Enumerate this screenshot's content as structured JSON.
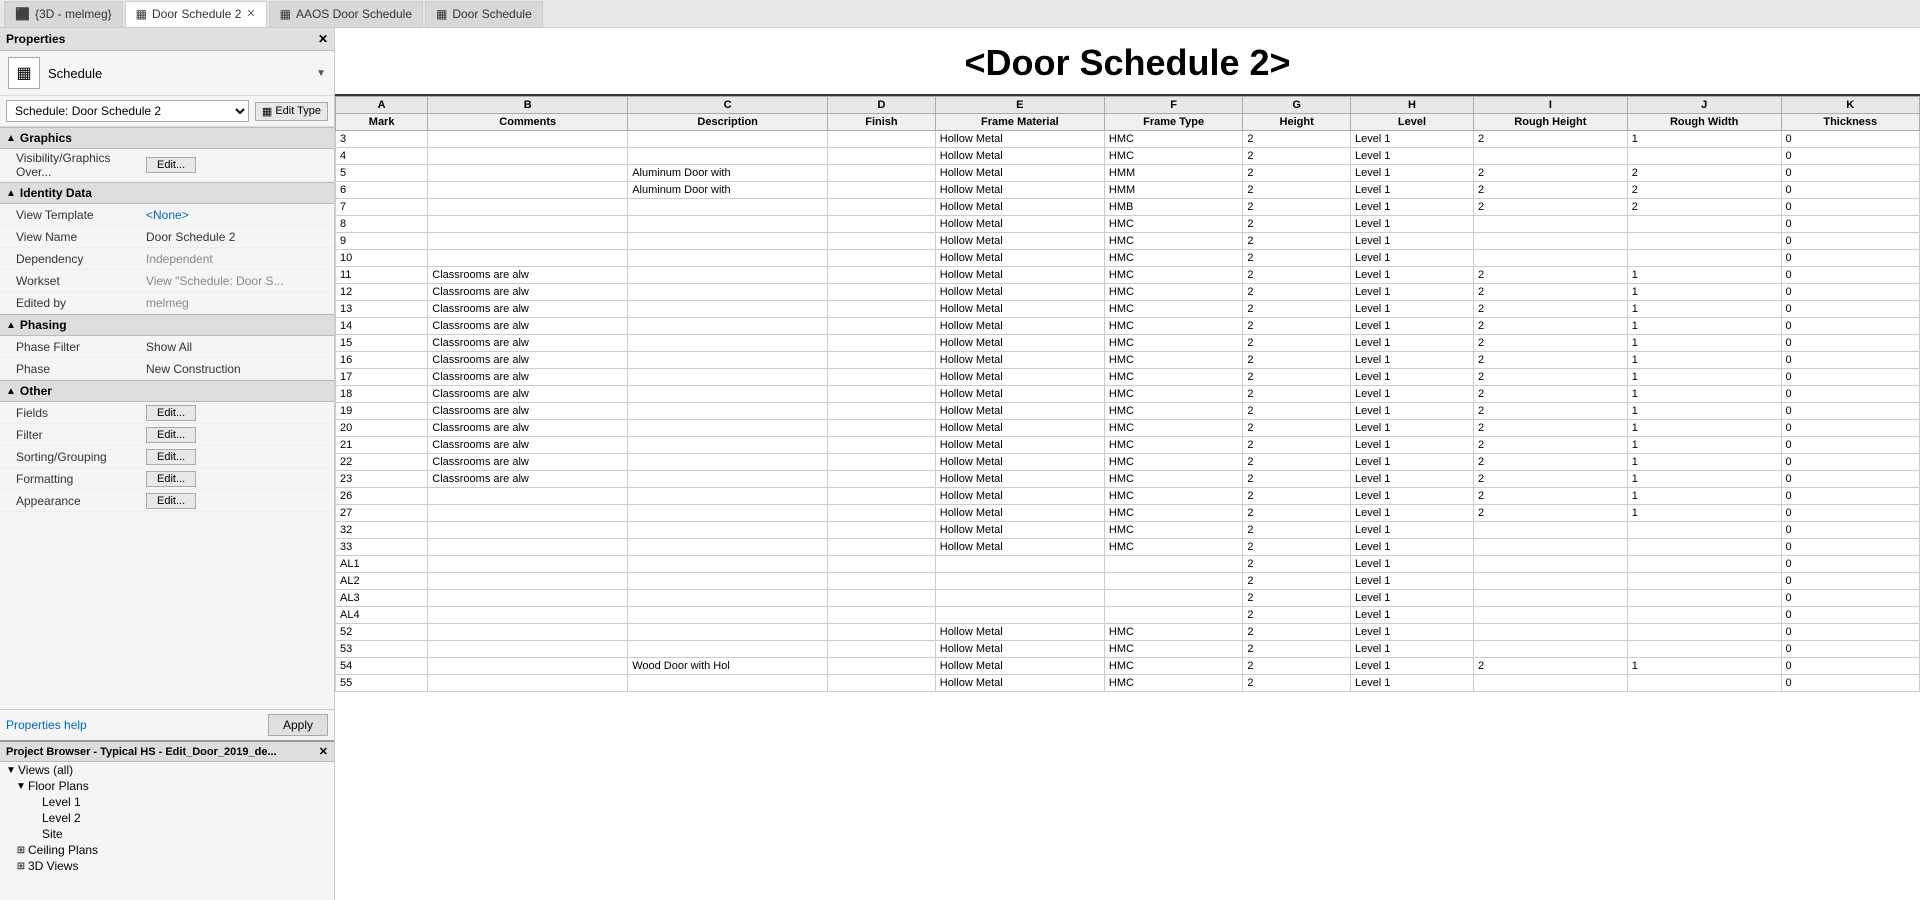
{
  "tabs": [
    {
      "id": "3d",
      "label": "{3D - melmeg}",
      "icon": "3d",
      "active": false,
      "closeable": false
    },
    {
      "id": "door2",
      "label": "Door Schedule 2",
      "icon": "table",
      "active": true,
      "closeable": true
    },
    {
      "id": "aaos",
      "label": "AAOS Door Schedule",
      "icon": "table",
      "active": false,
      "closeable": false
    },
    {
      "id": "door",
      "label": "Door Schedule",
      "icon": "table",
      "active": false,
      "closeable": false
    }
  ],
  "properties_panel": {
    "title": "Properties",
    "schedule_icon": "⊞",
    "schedule_type_label": "Schedule",
    "schedule_name": "Schedule: Door Schedule 2",
    "edit_type_label": "Edit Type",
    "sections": {
      "graphics": {
        "label": "Graphics",
        "items": [
          {
            "label": "Visibility/Graphics Over...",
            "value": "Edit...",
            "is_button": true
          }
        ]
      },
      "identity_data": {
        "label": "Identity Data",
        "items": [
          {
            "label": "View Template",
            "value": "<None>",
            "is_link": true
          },
          {
            "label": "View Name",
            "value": "Door Schedule 2",
            "is_button": false
          },
          {
            "label": "Dependency",
            "value": "Independent",
            "is_grayed": true
          },
          {
            "label": "Workset",
            "value": "View \"Schedule: Door S...",
            "is_grayed": true
          },
          {
            "label": "Edited by",
            "value": "melmeg",
            "is_grayed": true
          }
        ]
      },
      "phasing": {
        "label": "Phasing",
        "items": [
          {
            "label": "Phase Filter",
            "value": "Show All"
          },
          {
            "label": "Phase",
            "value": "New Construction"
          }
        ]
      },
      "other": {
        "label": "Other",
        "items": [
          {
            "label": "Fields",
            "value": "Edit...",
            "is_button": true
          },
          {
            "label": "Filter",
            "value": "Edit...",
            "is_button": true
          },
          {
            "label": "Sorting/Grouping",
            "value": "Edit...",
            "is_button": true
          },
          {
            "label": "Formatting",
            "value": "Edit...",
            "is_button": true
          },
          {
            "label": "Appearance",
            "value": "Edit...",
            "is_button": true
          }
        ]
      }
    },
    "properties_help_label": "Properties help",
    "apply_label": "Apply"
  },
  "project_browser": {
    "title": "Project Browser - Typical HS - Edit_Door_2019_de...",
    "tree": [
      {
        "label": "Views (all)",
        "indent": 0,
        "expand": "▼",
        "icon": "📁"
      },
      {
        "label": "Floor Plans",
        "indent": 1,
        "expand": "▼",
        "icon": "📁"
      },
      {
        "label": "Level 1",
        "indent": 2,
        "expand": "",
        "icon": "📄"
      },
      {
        "label": "Level 2",
        "indent": 2,
        "expand": "",
        "icon": "📄"
      },
      {
        "label": "Site",
        "indent": 2,
        "expand": "",
        "icon": "📄"
      },
      {
        "label": "Ceiling Plans",
        "indent": 1,
        "expand": "⊞",
        "icon": "📁"
      },
      {
        "label": "3D Views",
        "indent": 1,
        "expand": "⊞",
        "icon": "📁"
      }
    ]
  },
  "schedule": {
    "title": "<Door Schedule 2>",
    "columns": [
      {
        "letter": "A",
        "name": "Mark",
        "class": "col-a"
      },
      {
        "letter": "B",
        "name": "Comments",
        "class": "col-b"
      },
      {
        "letter": "C",
        "name": "Description",
        "class": "col-c"
      },
      {
        "letter": "D",
        "name": "Finish",
        "class": "col-d"
      },
      {
        "letter": "E",
        "name": "Frame Material",
        "class": "col-e"
      },
      {
        "letter": "F",
        "name": "Frame Type",
        "class": "col-f"
      },
      {
        "letter": "G",
        "name": "Height",
        "class": "col-g"
      },
      {
        "letter": "H",
        "name": "Level",
        "class": "col-h"
      },
      {
        "letter": "I",
        "name": "Rough Height",
        "class": "col-i"
      },
      {
        "letter": "J",
        "name": "Rough Width",
        "class": "col-j"
      },
      {
        "letter": "K",
        "name": "Thickness",
        "class": "col-k"
      }
    ],
    "rows": [
      {
        "mark": "3",
        "comments": "",
        "description": "",
        "finish": "",
        "frame_material": "Hollow Metal",
        "frame_type": "HMC",
        "height": "2",
        "level": "Level 1",
        "rough_height": "2",
        "rough_width": "1",
        "thickness": "0"
      },
      {
        "mark": "4",
        "comments": "",
        "description": "",
        "finish": "",
        "frame_material": "Hollow Metal",
        "frame_type": "HMC",
        "height": "2",
        "level": "Level 1",
        "rough_height": "",
        "rough_width": "",
        "thickness": "0"
      },
      {
        "mark": "5",
        "comments": "",
        "description": "Aluminum Door with",
        "finish": "",
        "frame_material": "Hollow Metal",
        "frame_type": "HMM",
        "height": "2",
        "level": "Level 1",
        "rough_height": "2",
        "rough_width": "2",
        "thickness": "0"
      },
      {
        "mark": "6",
        "comments": "",
        "description": "Aluminum Door with",
        "finish": "",
        "frame_material": "Hollow Metal",
        "frame_type": "HMM",
        "height": "2",
        "level": "Level 1",
        "rough_height": "2",
        "rough_width": "2",
        "thickness": "0"
      },
      {
        "mark": "7",
        "comments": "",
        "description": "",
        "finish": "",
        "frame_material": "Hollow Metal",
        "frame_type": "HMB",
        "height": "2",
        "level": "Level 1",
        "rough_height": "2",
        "rough_width": "2",
        "thickness": "0"
      },
      {
        "mark": "8",
        "comments": "",
        "description": "",
        "finish": "",
        "frame_material": "Hollow Metal",
        "frame_type": "HMC",
        "height": "2",
        "level": "Level 1",
        "rough_height": "",
        "rough_width": "",
        "thickness": "0"
      },
      {
        "mark": "9",
        "comments": "",
        "description": "",
        "finish": "",
        "frame_material": "Hollow Metal",
        "frame_type": "HMC",
        "height": "2",
        "level": "Level 1",
        "rough_height": "",
        "rough_width": "",
        "thickness": "0"
      },
      {
        "mark": "10",
        "comments": "",
        "description": "",
        "finish": "",
        "frame_material": "Hollow Metal",
        "frame_type": "HMC",
        "height": "2",
        "level": "Level 1",
        "rough_height": "",
        "rough_width": "",
        "thickness": "0"
      },
      {
        "mark": "11",
        "comments": "Classrooms are alw",
        "description": "",
        "finish": "",
        "frame_material": "Hollow Metal",
        "frame_type": "HMC",
        "height": "2",
        "level": "Level 1",
        "rough_height": "2",
        "rough_width": "1",
        "thickness": "0"
      },
      {
        "mark": "12",
        "comments": "Classrooms are alw",
        "description": "",
        "finish": "",
        "frame_material": "Hollow Metal",
        "frame_type": "HMC",
        "height": "2",
        "level": "Level 1",
        "rough_height": "2",
        "rough_width": "1",
        "thickness": "0"
      },
      {
        "mark": "13",
        "comments": "Classrooms are alw",
        "description": "",
        "finish": "",
        "frame_material": "Hollow Metal",
        "frame_type": "HMC",
        "height": "2",
        "level": "Level 1",
        "rough_height": "2",
        "rough_width": "1",
        "thickness": "0"
      },
      {
        "mark": "14",
        "comments": "Classrooms are alw",
        "description": "",
        "finish": "",
        "frame_material": "Hollow Metal",
        "frame_type": "HMC",
        "height": "2",
        "level": "Level 1",
        "rough_height": "2",
        "rough_width": "1",
        "thickness": "0"
      },
      {
        "mark": "15",
        "comments": "Classrooms are alw",
        "description": "",
        "finish": "",
        "frame_material": "Hollow Metal",
        "frame_type": "HMC",
        "height": "2",
        "level": "Level 1",
        "rough_height": "2",
        "rough_width": "1",
        "thickness": "0"
      },
      {
        "mark": "16",
        "comments": "Classrooms are alw",
        "description": "",
        "finish": "",
        "frame_material": "Hollow Metal",
        "frame_type": "HMC",
        "height": "2",
        "level": "Level 1",
        "rough_height": "2",
        "rough_width": "1",
        "thickness": "0"
      },
      {
        "mark": "17",
        "comments": "Classrooms are alw",
        "description": "",
        "finish": "",
        "frame_material": "Hollow Metal",
        "frame_type": "HMC",
        "height": "2",
        "level": "Level 1",
        "rough_height": "2",
        "rough_width": "1",
        "thickness": "0"
      },
      {
        "mark": "18",
        "comments": "Classrooms are alw",
        "description": "",
        "finish": "",
        "frame_material": "Hollow Metal",
        "frame_type": "HMC",
        "height": "2",
        "level": "Level 1",
        "rough_height": "2",
        "rough_width": "1",
        "thickness": "0"
      },
      {
        "mark": "19",
        "comments": "Classrooms are alw",
        "description": "",
        "finish": "",
        "frame_material": "Hollow Metal",
        "frame_type": "HMC",
        "height": "2",
        "level": "Level 1",
        "rough_height": "2",
        "rough_width": "1",
        "thickness": "0"
      },
      {
        "mark": "20",
        "comments": "Classrooms are alw",
        "description": "",
        "finish": "",
        "frame_material": "Hollow Metal",
        "frame_type": "HMC",
        "height": "2",
        "level": "Level 1",
        "rough_height": "2",
        "rough_width": "1",
        "thickness": "0"
      },
      {
        "mark": "21",
        "comments": "Classrooms are alw",
        "description": "",
        "finish": "",
        "frame_material": "Hollow Metal",
        "frame_type": "HMC",
        "height": "2",
        "level": "Level 1",
        "rough_height": "2",
        "rough_width": "1",
        "thickness": "0"
      },
      {
        "mark": "22",
        "comments": "Classrooms are alw",
        "description": "",
        "finish": "",
        "frame_material": "Hollow Metal",
        "frame_type": "HMC",
        "height": "2",
        "level": "Level 1",
        "rough_height": "2",
        "rough_width": "1",
        "thickness": "0"
      },
      {
        "mark": "23",
        "comments": "Classrooms are alw",
        "description": "",
        "finish": "",
        "frame_material": "Hollow Metal",
        "frame_type": "HMC",
        "height": "2",
        "level": "Level 1",
        "rough_height": "2",
        "rough_width": "1",
        "thickness": "0"
      },
      {
        "mark": "26",
        "comments": "",
        "description": "",
        "finish": "",
        "frame_material": "Hollow Metal",
        "frame_type": "HMC",
        "height": "2",
        "level": "Level 1",
        "rough_height": "2",
        "rough_width": "1",
        "thickness": "0"
      },
      {
        "mark": "27",
        "comments": "",
        "description": "",
        "finish": "",
        "frame_material": "Hollow Metal",
        "frame_type": "HMC",
        "height": "2",
        "level": "Level 1",
        "rough_height": "2",
        "rough_width": "1",
        "thickness": "0"
      },
      {
        "mark": "32",
        "comments": "",
        "description": "",
        "finish": "",
        "frame_material": "Hollow Metal",
        "frame_type": "HMC",
        "height": "2",
        "level": "Level 1",
        "rough_height": "",
        "rough_width": "",
        "thickness": "0"
      },
      {
        "mark": "33",
        "comments": "",
        "description": "",
        "finish": "",
        "frame_material": "Hollow Metal",
        "frame_type": "HMC",
        "height": "2",
        "level": "Level 1",
        "rough_height": "",
        "rough_width": "",
        "thickness": "0"
      },
      {
        "mark": "AL1",
        "comments": "",
        "description": "",
        "finish": "",
        "frame_material": "",
        "frame_type": "",
        "height": "2",
        "level": "Level 1",
        "rough_height": "",
        "rough_width": "",
        "thickness": "0"
      },
      {
        "mark": "AL2",
        "comments": "",
        "description": "",
        "finish": "",
        "frame_material": "",
        "frame_type": "",
        "height": "2",
        "level": "Level 1",
        "rough_height": "",
        "rough_width": "",
        "thickness": "0"
      },
      {
        "mark": "AL3",
        "comments": "",
        "description": "",
        "finish": "",
        "frame_material": "",
        "frame_type": "",
        "height": "2",
        "level": "Level 1",
        "rough_height": "",
        "rough_width": "",
        "thickness": "0"
      },
      {
        "mark": "AL4",
        "comments": "",
        "description": "",
        "finish": "",
        "frame_material": "",
        "frame_type": "",
        "height": "2",
        "level": "Level 1",
        "rough_height": "",
        "rough_width": "",
        "thickness": "0"
      },
      {
        "mark": "52",
        "comments": "",
        "description": "",
        "finish": "",
        "frame_material": "Hollow Metal",
        "frame_type": "HMC",
        "height": "2",
        "level": "Level 1",
        "rough_height": "",
        "rough_width": "",
        "thickness": "0"
      },
      {
        "mark": "53",
        "comments": "",
        "description": "",
        "finish": "",
        "frame_material": "Hollow Metal",
        "frame_type": "HMC",
        "height": "2",
        "level": "Level 1",
        "rough_height": "",
        "rough_width": "",
        "thickness": "0"
      },
      {
        "mark": "54",
        "comments": "",
        "description": "Wood Door with Hol",
        "finish": "",
        "frame_material": "Hollow Metal",
        "frame_type": "HMC",
        "height": "2",
        "level": "Level 1",
        "rough_height": "2",
        "rough_width": "1",
        "thickness": "0"
      },
      {
        "mark": "55",
        "comments": "",
        "description": "",
        "finish": "",
        "frame_material": "Hollow Metal",
        "frame_type": "HMC",
        "height": "2",
        "level": "Level 1",
        "rough_height": "",
        "rough_width": "",
        "thickness": "0"
      }
    ]
  }
}
